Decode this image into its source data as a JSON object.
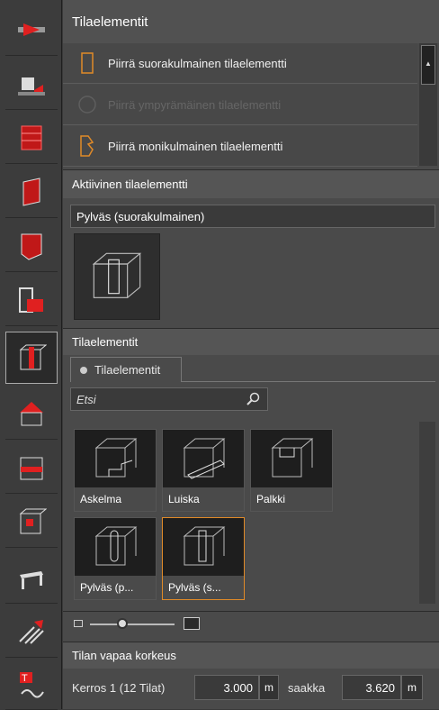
{
  "colors": {
    "accent": "#e02020",
    "highlight": "#e08a28"
  },
  "toolbar": {
    "tools": [
      "arrows-icon",
      "object-icon",
      "room-stack-icon",
      "wall-plane-icon",
      "slab-icon",
      "section-icon",
      "column-element-icon",
      "roof-box-icon",
      "story-box-icon",
      "face-box-icon",
      "table-icon",
      "hatch-icon",
      "text-icon"
    ],
    "active_index": 6
  },
  "header": {
    "title": "Tilaelementit"
  },
  "draw_menu": {
    "items": [
      {
        "label": "Piirrä suorakulmainen tilaelementti",
        "enabled": true
      },
      {
        "label": "Piirrä ympyrämäinen tilaelementti",
        "enabled": false
      },
      {
        "label": "Piirrä monikulmainen tilaelementti",
        "enabled": true
      }
    ]
  },
  "active_element": {
    "title": "Aktiivinen tilaelementti",
    "value": "Pylväs (suorakulmainen)"
  },
  "library": {
    "title": "Tilaelementit",
    "tab_label": "Tilaelementit",
    "search_placeholder": "Etsi",
    "items": [
      {
        "label": "Askelma",
        "selected": false
      },
      {
        "label": "Luiska",
        "selected": false
      },
      {
        "label": "Palkki",
        "selected": false
      },
      {
        "label": "Pylväs (p...",
        "selected": false
      },
      {
        "label": "Pylväs (s...",
        "selected": true
      }
    ]
  },
  "free_height": {
    "title": "Tilan vapaa korkeus",
    "floor_label": "Kerros 1 (12 Tilat)",
    "from_value": "3.000",
    "from_unit": "m",
    "to_label": "saakka",
    "to_value": "3.620",
    "to_unit": "m"
  }
}
